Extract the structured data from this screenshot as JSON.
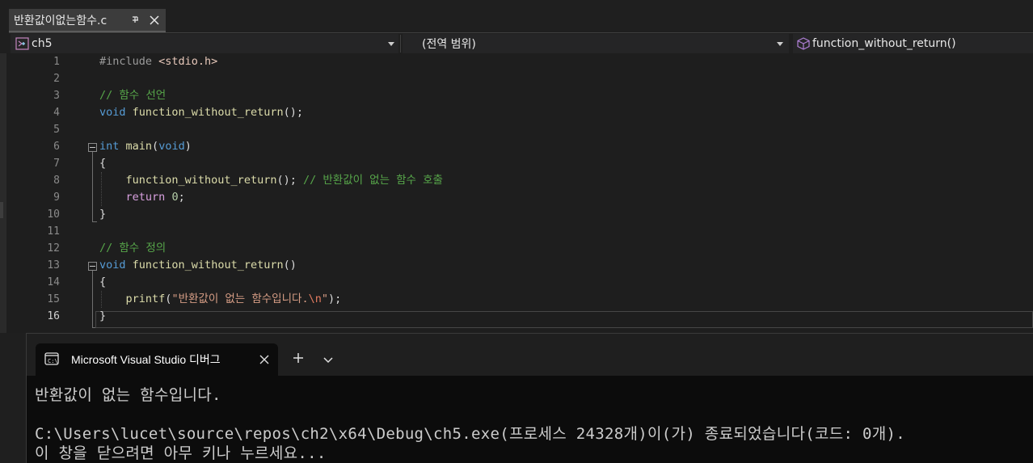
{
  "tabs": {
    "active": {
      "title": "반환값이없는함수.c",
      "pin_icon": "pin-icon",
      "close_icon": "close-icon"
    }
  },
  "navbar": {
    "project": "ch5",
    "scope": "(전역 범위)",
    "member": "function_without_return()"
  },
  "editor": {
    "current_line": 16,
    "line_numbers": [
      "1",
      "2",
      "3",
      "4",
      "5",
      "6",
      "7",
      "8",
      "9",
      "10",
      "11",
      "12",
      "13",
      "14",
      "15",
      "16"
    ],
    "lines": {
      "l1": {
        "directive": "#include ",
        "header": "<stdio.h>"
      },
      "l3": {
        "comment": "// 함수 선언"
      },
      "l4": {
        "kw": "void",
        "name": "function_without_return",
        "rest": "();"
      },
      "l6": {
        "kw": "int",
        "name": "main",
        "open": "(",
        "param": "void",
        "close": ")"
      },
      "l7": {
        "text": "{"
      },
      "l8": {
        "name": "function_without_return",
        "rest": "(); ",
        "comment": "// 반환값이 없는 함수 호출"
      },
      "l9": {
        "kw": "return",
        "space": " ",
        "num": "0",
        "rest": ";"
      },
      "l10": {
        "text": "}"
      },
      "l12": {
        "comment": "// 함수 정의"
      },
      "l13": {
        "kw": "void",
        "name": "function_without_return",
        "rest": "()"
      },
      "l14": {
        "text": "{"
      },
      "l15": {
        "name": "printf",
        "open": "(",
        "str": "\"반환값이 없는 함수입니다.",
        "esc": "\\n",
        "strend": "\"",
        "rest": ");"
      },
      "l16": {
        "text": "}"
      }
    }
  },
  "terminal": {
    "tab_title": "Microsoft Visual Studio 디버그",
    "output": [
      "반환값이 없는 함수입니다.",
      "",
      "C:\\Users\\lucet\\source\\repos\\ch2\\x64\\Debug\\ch5.exe(프로세스 24328개)이(가) 종료되었습니다(코드: 0개).",
      "이 창을 닫으려면 아무 키나 누르세요..."
    ]
  }
}
